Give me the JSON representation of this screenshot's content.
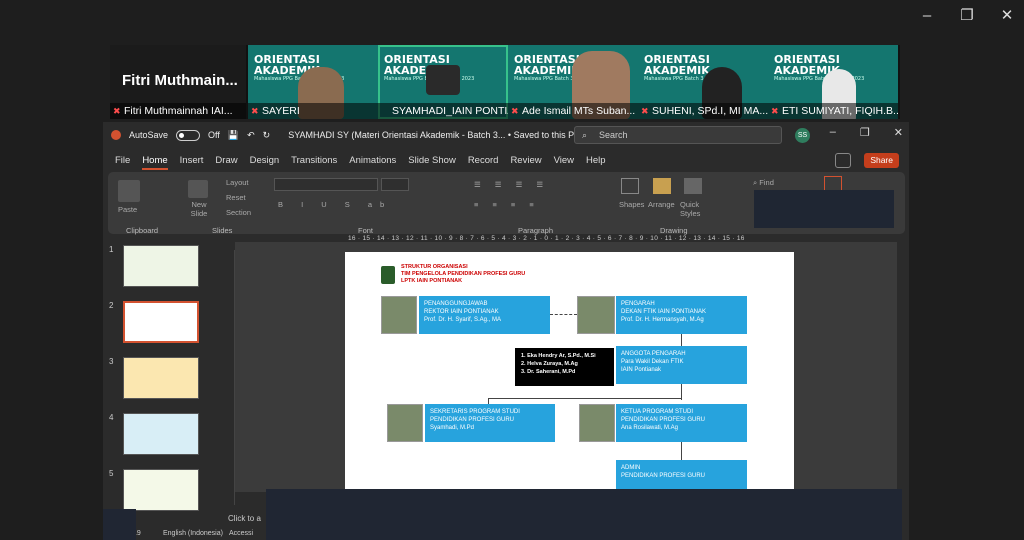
{
  "window": {
    "minimize": "–",
    "restore": "❐",
    "close": "✕"
  },
  "meeting": {
    "self_name": "Fitri Muthmain...",
    "self_label": "Fitri Muthmainnah IAI...",
    "tile_heading": "ORIENTASI AKADEMIK",
    "tile_sub": "Mahasiswa PPG Batch 3 Tahun 2023",
    "participants": [
      {
        "label": "SAYERI"
      },
      {
        "label": "SYAMHADI_IAIN PONTIA..."
      },
      {
        "label": "Ade Ismail MTs Suban..."
      },
      {
        "label": "SUHENI, SPd.I, MI MA..."
      },
      {
        "label": "ETI SUMIYATI, FIQIH.B..."
      }
    ]
  },
  "ppt": {
    "autosave": "AutoSave",
    "toggle": "Off",
    "doc_title": "SYAMHADI SY (Materi Orientasi Akademik - Batch 3...  •  Saved to this PC ⌄",
    "search_placeholder": "Search",
    "avatar": "SS",
    "share": "Share",
    "menu": [
      "File",
      "Home",
      "Insert",
      "Draw",
      "Design",
      "Transitions",
      "Animations",
      "Slide Show",
      "Record",
      "Review",
      "View",
      "Help"
    ],
    "ribbon": {
      "paste": "Paste",
      "new_slide": "New Slide",
      "layout": "Layout",
      "reset": "Reset",
      "section": "Section",
      "shapes": "Shapes",
      "arrange": "Arrange",
      "quick_styles": "Quick Styles",
      "find": "Find",
      "groups": {
        "clipboard": "Clipboard",
        "slides": "Slides",
        "font": "Font",
        "paragraph": "Paragraph",
        "drawing": "Drawing"
      }
    },
    "ruler": "16 · 15 · 14 · 13 · 12 · 11 · 10 · 9 · 8 · 7 · 6 · 5 · 4 · 3 · 2 · 1 · 0 · 1 · 2 · 3 · 4 · 5 · 6 · 7 · 8 · 9 · 10 · 11 · 12 · 13 · 14 · 15 · 16",
    "thumbnails": [
      "1",
      "2",
      "3",
      "4",
      "5"
    ],
    "notes": "Click to a",
    "status": {
      "slide": "19",
      "language": "English (Indonesia)",
      "accessibility": "Accessi"
    }
  },
  "slide": {
    "header": [
      "STRUKTUR ORGANISASI",
      "TIM PENGELOLA PENDIDIKAN PROFESI GURU",
      "LPTK IAIN PONTIANAK"
    ],
    "penanggung": [
      "PENANGGUNGJAWAB",
      "REKTOR IAIN PONTIANAK",
      "Prof. Dr. H. Syarif, S.Ag., MA"
    ],
    "pengarah": [
      "PENGARAH",
      "DEKAN FTIK IAIN PONTIANAK",
      "Prof. Dr. H. Hermansyah, M.Ag"
    ],
    "anggota": [
      "ANGGOTA PENGARAH",
      "Para Wakil Dekan FTIK",
      "IAIN Pontianak"
    ],
    "black_box": [
      "1.   Eka Hendry Ar, S.Pd., M.Si",
      "2.   Helva Zuraya, M.Ag",
      "3.   Dr. Saherani, M.Pd"
    ],
    "sekretaris": [
      "SEKRETARIS PROGRAM STUDI",
      "PENDIDIKAN PROFESI GURU",
      "Syamhadi, M.Pd"
    ],
    "ketua": [
      "KETUA PROGRAM STUDI",
      "PENDIDIKAN PROFESI GURU",
      "Ana Rosilawati, M.Ag"
    ],
    "admin": [
      "ADMIN",
      "PENDIDIKAN PROFESI GURU"
    ]
  }
}
